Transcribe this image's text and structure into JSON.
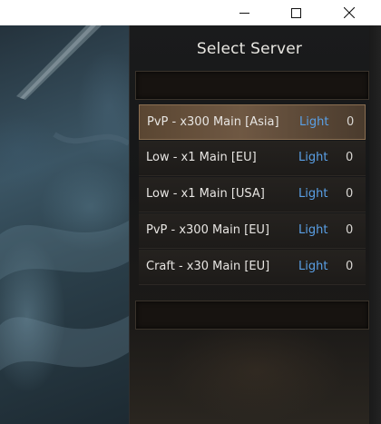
{
  "window_controls": {
    "minimize_icon": "minimize-icon",
    "maximize_icon": "maximize-icon",
    "close_icon": "close-icon"
  },
  "panel": {
    "title": "Select Server"
  },
  "servers": [
    {
      "name": "PvP - x300 Main [Asia]",
      "status": "Light",
      "count": "0",
      "selected": true
    },
    {
      "name": "Low - x1 Main [EU]",
      "status": "Light",
      "count": "0",
      "selected": false
    },
    {
      "name": "Low - x1 Main [USA]",
      "status": "Light",
      "count": "0",
      "selected": false
    },
    {
      "name": "PvP - x300 Main [EU]",
      "status": "Light",
      "count": "0",
      "selected": false
    },
    {
      "name": "Craft - x30 Main [EU]",
      "status": "Light",
      "count": "0",
      "selected": false
    }
  ],
  "colors": {
    "status_light": "#5aa0e6",
    "selected_row": "#6f5843",
    "panel_bg": "#171819"
  }
}
